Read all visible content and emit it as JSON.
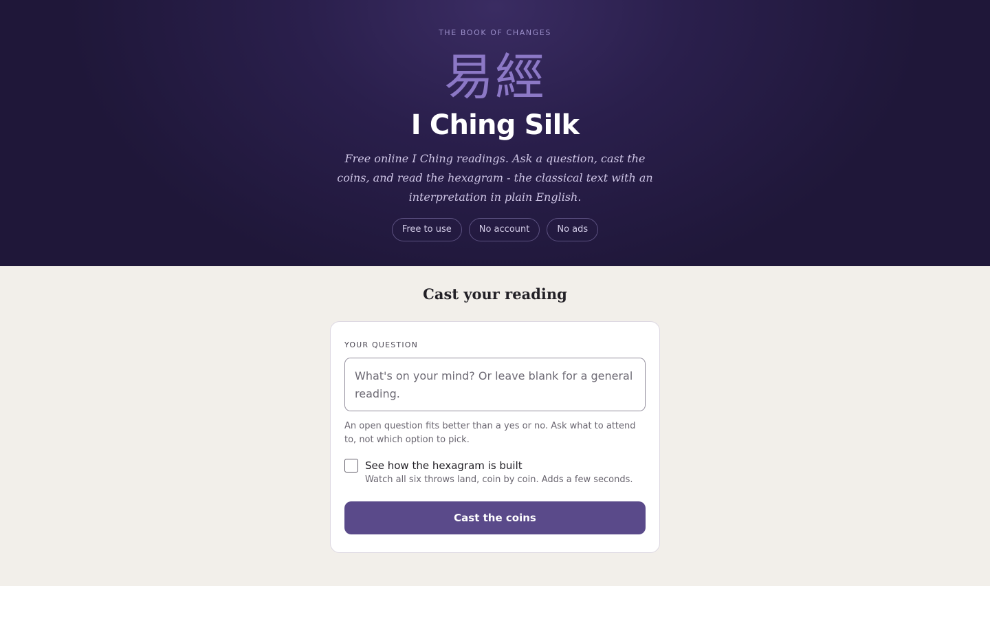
{
  "hero": {
    "eyebrow": "THE BOOK OF CHANGES",
    "hanzi": "易經",
    "title": "I Ching Silk",
    "subtitle": "Free online I Ching readings. Ask a question, cast the coins, and read the hexagram - the classical text with an interpretation in plain English.",
    "pills": [
      {
        "label": "Free to use"
      },
      {
        "label": "No account"
      },
      {
        "label": "No ads"
      }
    ]
  },
  "reading": {
    "section_title": "Cast your reading",
    "question_label": "YOUR QUESTION",
    "question_value": "",
    "question_placeholder": "What's on your mind? Or leave blank for a general reading.",
    "hint": "An open question fits better than a yes or no. Ask what to attend to, not which option to pick.",
    "show_build_label": "See how the hexagram is built",
    "show_build_sub": "Watch all six throws land, coin by coin. Adds a few seconds.",
    "show_build_checked": false,
    "cast_button": "Cast the coins"
  },
  "colors": {
    "hero_bg": "#231a42",
    "accent": "#5a4a8a",
    "page_bg": "#f2efea",
    "hanzi": "#8c78c6"
  }
}
